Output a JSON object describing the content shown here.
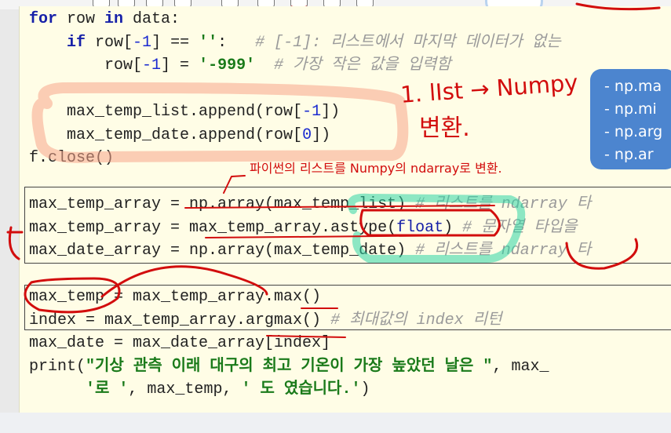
{
  "editor": {
    "code_lines": [
      "for row in data:",
      "    if row[-1] == '':   # [-1]: 리스트에서 마지막 데이터가 없는",
      "        row[-1] = '-999'  # 가장 작은 값을 입력함",
      "",
      "    max_temp_list.append(row[-1])",
      "    max_temp_date.append(row[0])",
      "f.close()",
      "",
      "max_temp_array = np.array(max_temp_list) # 리스트를 ndarray 타",
      "max_temp_array = max_temp_array.astype(float) # 문자열 타입을",
      "max_date_array = np.array(max_temp_date) # 리스트를 ndarray 타",
      "",
      "max_temp = max_temp_array.max()",
      "index = max_temp_array.argmax() # 최대값의 index 리턴",
      "max_date = max_date_array[index]",
      "print(\"기상 관측 이래 대구의 최고 기온이 가장 높았던 날은 \", max_",
      "      '로 ', max_temp, ' 도 였습니다.')"
    ]
  },
  "hint_card": {
    "items": [
      "np.ma",
      "np.mi",
      "np.arg",
      "np.ar"
    ],
    "color": "#4c85cf"
  },
  "annotations": {
    "main": "1. lIst → Numpy",
    "sub": "변환.",
    "note": "파이썬의 리스트를  Numpy의 ndarray로 변환.",
    "ink_color": "#d20d0d",
    "highlight_color": "#2fd6a6"
  }
}
